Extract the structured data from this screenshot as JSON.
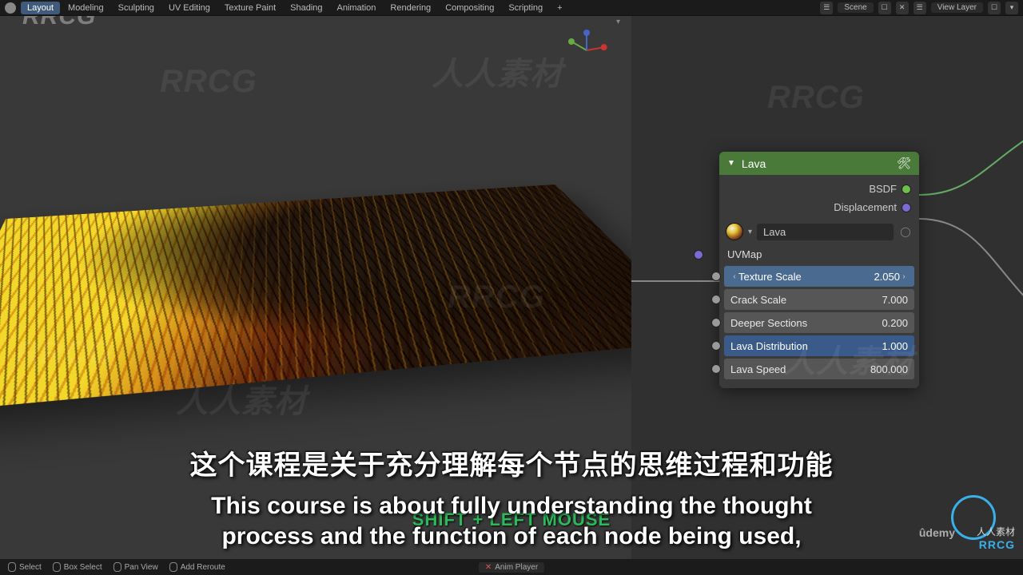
{
  "menu": {
    "items": [
      "Layout",
      "Modeling",
      "Sculpting",
      "UV Editing",
      "Texture Paint",
      "Shading",
      "Animation",
      "Rendering",
      "Compositing",
      "Scripting"
    ],
    "active_index": 0,
    "scene_label": "Scene",
    "viewlayer_label": "View Layer"
  },
  "node": {
    "title": "Lava",
    "outputs": [
      {
        "label": "BSDF",
        "color": "green"
      },
      {
        "label": "Displacement",
        "color": "purple"
      }
    ],
    "material_name": "Lava",
    "input_socket": "UVMap",
    "params": [
      {
        "label": "Texture Scale",
        "value": "2.050",
        "arrows": true
      },
      {
        "label": "Crack Scale",
        "value": "7.000"
      },
      {
        "label": "Deeper Sections",
        "value": "0.200"
      },
      {
        "label": "Lava Distribution",
        "value": "1.000",
        "active": true
      },
      {
        "label": "Lava Speed",
        "value": "800.000"
      }
    ]
  },
  "subtitles": {
    "cn": "这个课程是关于充分理解每个节点的思维过程和功能",
    "en_line1": "This course is about fully understanding the thought",
    "en_line2": "process and the function of each node being used,",
    "shortcut": "SHIFT + LEFT MOUSE"
  },
  "statusbar": {
    "select": "Select",
    "box": "Box Select",
    "pan": "Pan View",
    "reroute": "Add Reroute",
    "anim": "Anim Player"
  },
  "watermarks": {
    "rrcg": "RRCG",
    "rrcg_cn": "人人素材",
    "udemy": "ûdemy",
    "faint": "RRCG"
  }
}
